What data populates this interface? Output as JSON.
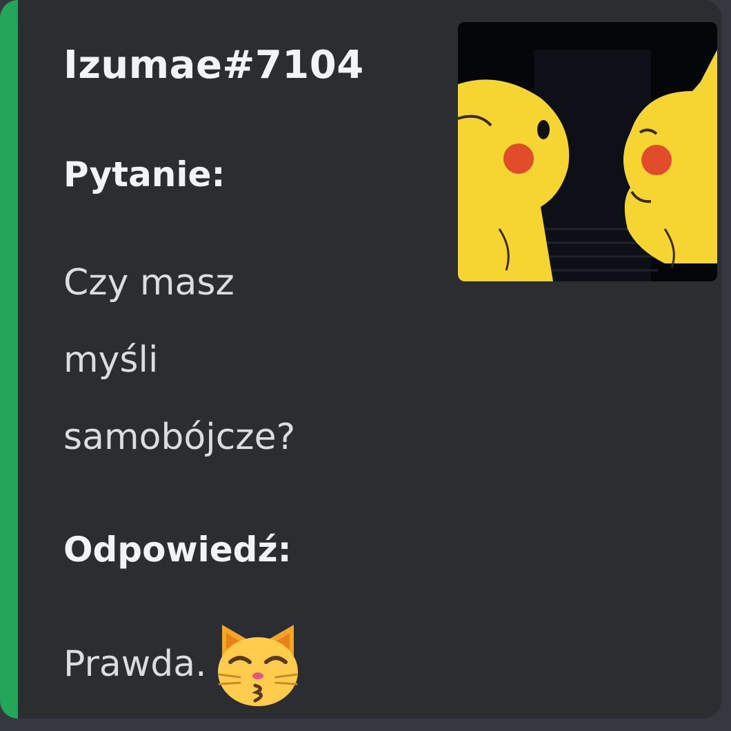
{
  "embed": {
    "accent_color": "#23a55a",
    "author": "Izumae#7104",
    "thumbnail_icon": "pikachu-image",
    "fields": [
      {
        "name": "Pytanie:",
        "value": "Czy masz\nmyśli\nsamobójcze?"
      },
      {
        "name": "Odpowiedź:",
        "value": "Prawda.",
        "emoji": "kissing-cat-emoji"
      }
    ]
  }
}
